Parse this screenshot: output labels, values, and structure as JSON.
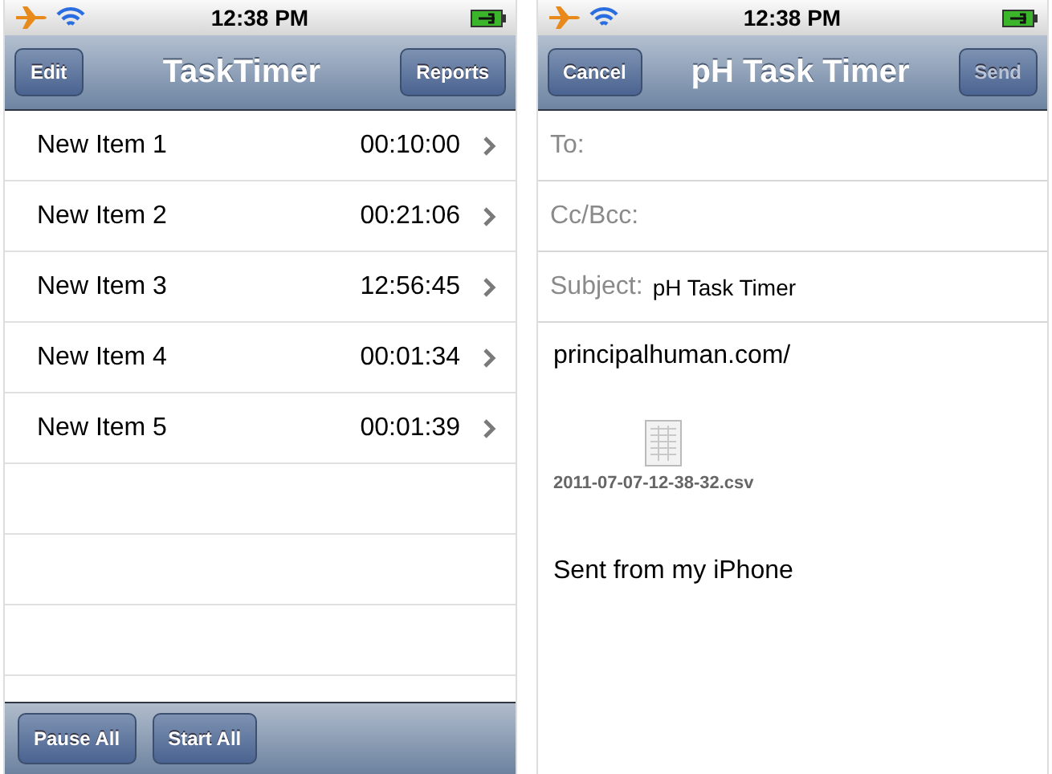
{
  "screens": [
    {
      "status_bar": {
        "time": "12:38 PM"
      },
      "nav": {
        "title": "TaskTimer",
        "left_button": {
          "label": "Edit",
          "disabled": false
        },
        "right_button": {
          "label": "Reports",
          "disabled": false
        }
      },
      "items": [
        {
          "name": "New Item 1",
          "time": "00:10:00"
        },
        {
          "name": "New Item 2",
          "time": "00:21:06"
        },
        {
          "name": "New Item 3",
          "time": "12:56:45"
        },
        {
          "name": "New Item 4",
          "time": "00:01:34"
        },
        {
          "name": "New Item 5",
          "time": "00:01:39"
        }
      ],
      "toolbar": [
        "Pause All",
        "Start All"
      ]
    },
    {
      "status_bar": {
        "time": "12:38 PM"
      },
      "nav": {
        "title": "pH Task Timer",
        "left_button": {
          "label": "Cancel",
          "disabled": false
        },
        "right_button": {
          "label": "Send",
          "disabled": true
        }
      },
      "fields": [
        {
          "label": "To:"
        },
        {
          "label": "Cc/Bcc:"
        },
        {
          "label": "Subject:",
          "value": "pH Task Timer"
        }
      ],
      "body": {
        "link": "principalhuman.com/",
        "attachment": "2011-07-07-12-38-32.csv",
        "signature": "Sent from my iPhone"
      }
    }
  ]
}
